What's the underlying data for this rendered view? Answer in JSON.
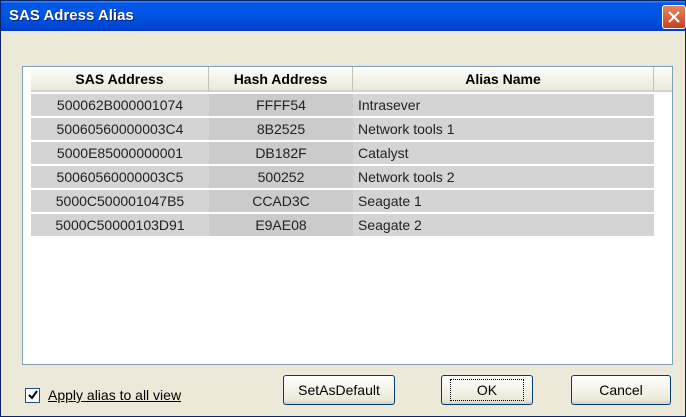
{
  "window": {
    "title": "SAS Adress Alias"
  },
  "table": {
    "columns": [
      "SAS Address",
      "Hash Address",
      "Alias Name"
    ],
    "rows": [
      {
        "sas": "500062B000001074",
        "hash": "FFFF54",
        "alias": "Intrasever"
      },
      {
        "sas": "50060560000003C4",
        "hash": "8B2525",
        "alias": "Network tools 1"
      },
      {
        "sas": "5000E85000000001",
        "hash": "DB182F",
        "alias": "Catalyst"
      },
      {
        "sas": "50060560000003C5",
        "hash": "500252",
        "alias": "Network tools 2"
      },
      {
        "sas": "5000C500001047B5",
        "hash": "CCAD3C",
        "alias": "Seagate 1"
      },
      {
        "sas": "5000C50000103D91",
        "hash": "E9AE08",
        "alias": "Seagate 2"
      }
    ]
  },
  "footer": {
    "apply_label": "Apply alias to all view",
    "apply_checked": true,
    "setdefault_label": "SetAsDefault",
    "ok_label": "OK",
    "cancel_label": "Cancel"
  }
}
